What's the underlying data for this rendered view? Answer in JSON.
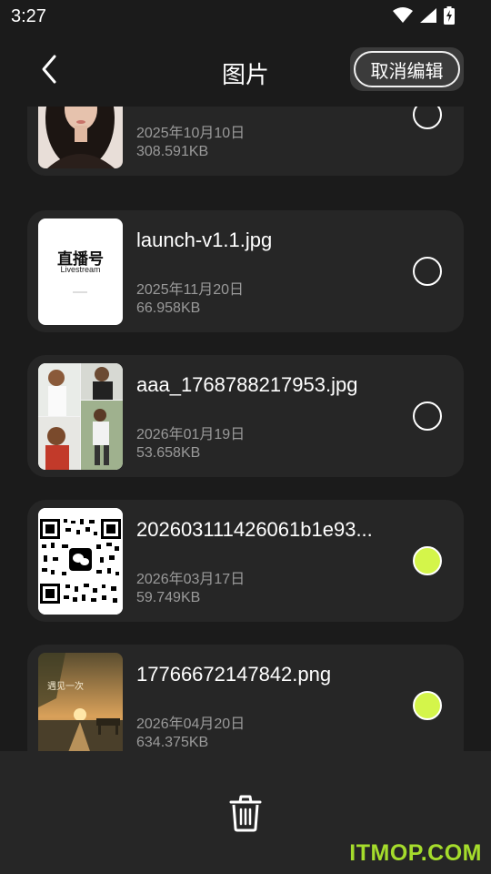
{
  "status_bar": {
    "time": "3:27"
  },
  "header": {
    "title": "图片",
    "cancel_edit_label": "取消编辑"
  },
  "files": [
    {
      "name": "",
      "date": "2025年10月10日",
      "size": "308.591KB",
      "selected": false,
      "thumbnail": "portrait"
    },
    {
      "name": "launch-v1.1.jpg",
      "date": "2025年11月20日",
      "size": "66.958KB",
      "selected": false,
      "thumbnail": "logo"
    },
    {
      "name": "aaa_1768788217953.jpg",
      "date": "2026年01月19日",
      "size": "53.658KB",
      "selected": false,
      "thumbnail": "collage"
    },
    {
      "name": "202603111426061b1e93...",
      "date": "2026年03月17日",
      "size": "59.749KB",
      "selected": true,
      "thumbnail": "qr"
    },
    {
      "name": "17766672147842.png",
      "date": "2026年04月20日",
      "size": "634.375KB",
      "selected": true,
      "thumbnail": "sunset"
    }
  ],
  "thumb_text": {
    "logo_brand": "直播号",
    "logo_sub": "Livestream",
    "sunset_caption": "遇见一次"
  },
  "watermark": "ITMOP.COM",
  "colors": {
    "background": "#1b1b1b",
    "card": "#262626",
    "selected": "#d4f54a",
    "secondary_text": "#9a9a9a",
    "watermark": "#a5dc2c"
  },
  "icons": {
    "back": "chevron-left-icon",
    "delete": "trash-icon",
    "wifi": "wifi-icon",
    "signal": "signal-icon",
    "battery": "battery-icon"
  }
}
